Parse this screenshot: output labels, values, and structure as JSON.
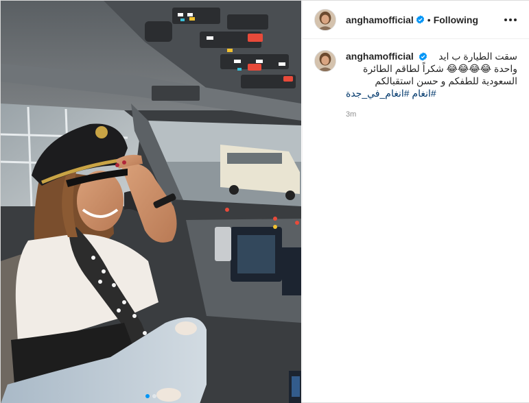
{
  "post": {
    "username": "anghamofficial",
    "follow_state": "Following",
    "separator": "•",
    "verified_icon": "verified-badge-icon",
    "accent_color": "#0095f6",
    "link_color": "#00376b",
    "caption": {
      "line1": "سقت الطيارة ب ايد",
      "line2": "واحدة 😂😂😂😂 شكراً لطاقم الطائرة",
      "line3": "السعودية للطفكم و حسن استقبالكم",
      "hashtags": [
        "#انغام_في_جدة",
        "#انغام"
      ]
    },
    "timestamp": "3m"
  },
  "carousel": {
    "total": 2,
    "current": 1
  }
}
